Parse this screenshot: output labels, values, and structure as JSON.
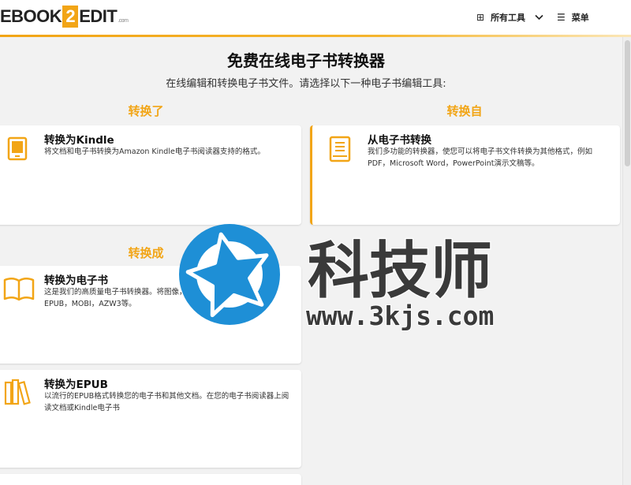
{
  "header": {
    "logo": {
      "left": "EBOOK",
      "mid": "2",
      "right": "EDIT",
      "suffix": ".com"
    },
    "nav": {
      "tools_label": "所有工具",
      "menu_label": "菜单"
    }
  },
  "hero": {
    "title": "免费在线电子书转换器",
    "subtitle": "在线编辑和转换电子书文件。请选择以下一种电子书编辑工具:"
  },
  "sections": {
    "convert_to": "转换了",
    "convert_from": "转换自",
    "convert_into": "转换成"
  },
  "cards": {
    "kindle": {
      "title": "转换为Kindle",
      "desc": "将文档和电子书转换为Amazon Kindle电子书阅读器支持的格式。"
    },
    "from_ebook": {
      "title": "从电子书转换",
      "desc": "我们多功能的转换器，使您可以将电子书文件转换为其他格式，例如PDF，Microsoft Word，PowerPoint演示文稿等。"
    },
    "ebook": {
      "title": "转换为电子书",
      "desc": "这是我们的高质量电子书转换器。将图像，PDF或电子书文件转换为EPUB，MOBI，AZW3等。"
    },
    "epub": {
      "title": "转换为EPUB",
      "desc": "以流行的EPUB格式转换您的电子书和其他文档。在您的电子书阅读器上阅读文档或Kindle电子书"
    }
  },
  "watermark": {
    "text": "科技师",
    "url": "www.3kjs.com"
  },
  "colors": {
    "accent": "#f2a516",
    "watermark_blue": "#1e8fd6"
  },
  "icons": [
    "grid-icon",
    "chevron-down-icon",
    "menu-icon",
    "kindle-icon",
    "book-icon",
    "open-book-icon",
    "books-shelf-icon"
  ]
}
